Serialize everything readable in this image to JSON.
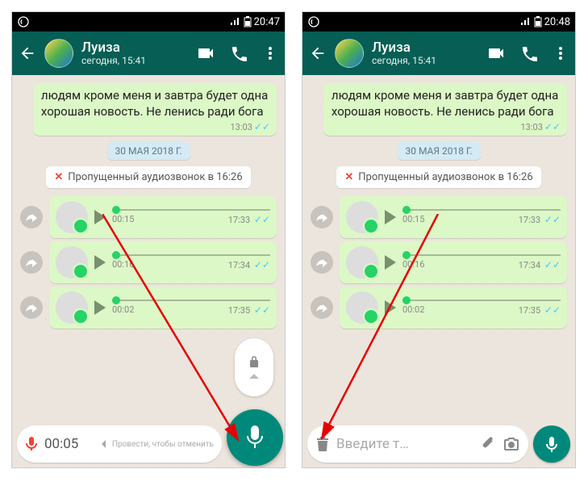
{
  "screens": [
    {
      "status_time": "20:47",
      "contact": {
        "name": "Луиза",
        "subtitle": "сегодня, 15:41"
      },
      "message": {
        "text": "людям кроме меня и завтра будет одна хорошая новость. Не ленись ради бога",
        "time": "13:03"
      },
      "date_chip": "30 МАЯ 2018 Г.",
      "missed_call": "Пропущенный аудиозвонок в 16:26",
      "voice": [
        {
          "dur": "00:15",
          "time": "17:33"
        },
        {
          "dur": "00:16",
          "time": "17:34"
        },
        {
          "dur": "00:02",
          "time": "17:35"
        }
      ],
      "recording": {
        "timer": "00:05",
        "cancel_hint": "Провести, чтобы отменить"
      }
    },
    {
      "status_time": "20:48",
      "contact": {
        "name": "Луиза",
        "subtitle": "сегодня, 15:41"
      },
      "message": {
        "text": "людям кроме меня и завтра будет одна хорошая новость. Не ленись ради бога",
        "time": "13:03"
      },
      "date_chip": "30 МАЯ 2018 Г.",
      "missed_call": "Пропущенный аудиозвонок в 16:26",
      "voice": [
        {
          "dur": "00:15",
          "time": "17:33"
        },
        {
          "dur": "00:16",
          "time": "17:34"
        },
        {
          "dur": "00:02",
          "time": "17:35"
        }
      ],
      "input_placeholder": "Введите т…"
    }
  ]
}
